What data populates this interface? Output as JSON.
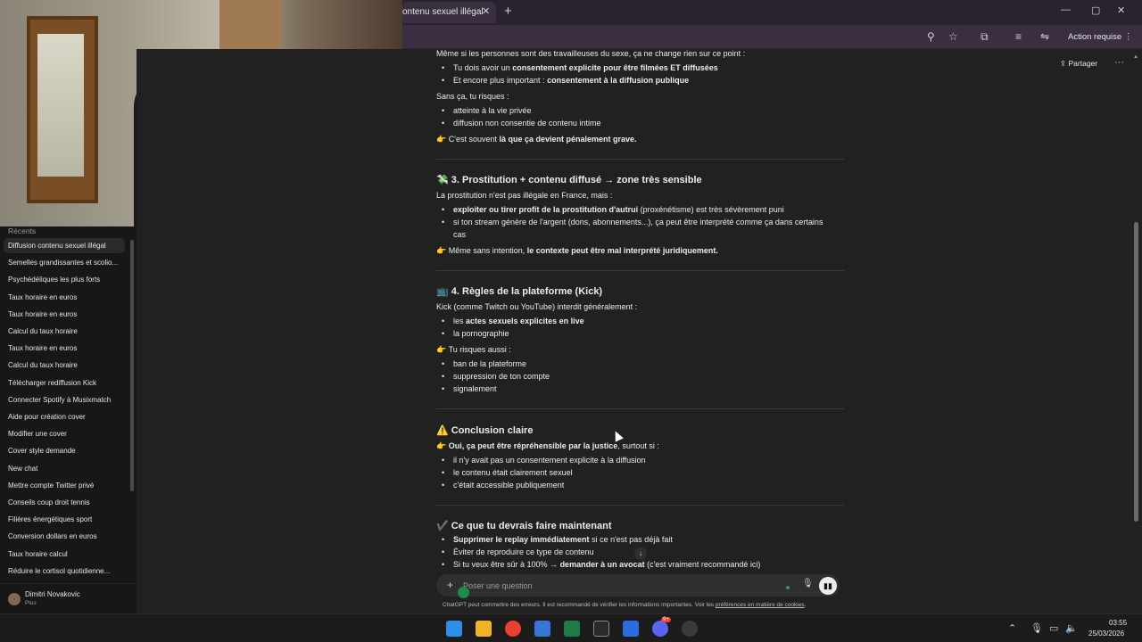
{
  "browser": {
    "tab_title": "ontenu sexuel illégal",
    "tab_close": "✕",
    "new_tab": "+",
    "window_controls": [
      "—",
      "▢",
      "✕"
    ],
    "action_button": "Action requise",
    "toolbar_icons": [
      "zoom-icon",
      "star-icon",
      "extensions-icon",
      "media-icon",
      "profile-icon",
      "menu-icon"
    ]
  },
  "header": {
    "share_label": "Partager",
    "more": "···"
  },
  "sidebar": {
    "recents_label": "Récents",
    "items": [
      {
        "label": "Diffusion contenu sexuel illégal",
        "active": true
      },
      {
        "label": "Semelles grandissantes et scolio..."
      },
      {
        "label": "Psychédéliques les plus forts"
      },
      {
        "label": "Taux horaire en euros"
      },
      {
        "label": "Taux horaire en euros"
      },
      {
        "label": "Calcul du taux horaire"
      },
      {
        "label": "Taux horaire en euros"
      },
      {
        "label": "Calcul du taux horaire"
      },
      {
        "label": "Télécharger rediffusion Kick"
      },
      {
        "label": "Connecter Spotify à Musixmatch"
      },
      {
        "label": "Aide pour création cover"
      },
      {
        "label": "Modifier une cover"
      },
      {
        "label": "Cover style demande"
      },
      {
        "label": "New chat"
      },
      {
        "label": "Mettre compte Twitter privé"
      },
      {
        "label": "Conseils coup droit tennis"
      },
      {
        "label": "Filières énergétiques sport"
      },
      {
        "label": "Conversion dollars en euros"
      },
      {
        "label": "Taux horaire calcul"
      },
      {
        "label": "Réduire le cortisol quotidienne..."
      }
    ],
    "user": {
      "name": "Dimitri Novakovic",
      "plan": "Plus"
    }
  },
  "content": {
    "intro": "Même si les personnes sont des travailleuses du sexe, ça ne change rien sur ce point :",
    "consent_bullets": [
      {
        "pre": "Tu dois avoir un ",
        "bold": "consentement explicite pour être filmées ET diffusées",
        "post": ""
      },
      {
        "pre": "Et encore plus important : ",
        "bold": "consentement à la diffusion publique",
        "post": ""
      }
    ],
    "risks_intro": "Sans ça, tu risques :",
    "risks": [
      "atteinte à la vie privée",
      "diffusion non consentie de contenu intime"
    ],
    "risk_note": {
      "emoji": "👉",
      "pre": "C'est souvent ",
      "bold": "là que ça devient pénalement grave.",
      "post": ""
    },
    "section3": {
      "emoji": "💸",
      "title": "3. Prostitution + contenu diffusé → zone très sensible",
      "intro": "La prostitution n'est pas illégale en France, mais :",
      "bullets": [
        {
          "bold": "exploiter ou tirer profit de la prostitution d'autrui",
          "post": " (proxénétisme) est très sévèrement puni"
        },
        {
          "bold": "",
          "post": "si ton stream génère de l'argent (dons, abonnements...), ça peut être interprété comme ça dans certains"
        },
        {
          "bold": "",
          "post": "cas"
        }
      ],
      "note": {
        "emoji": "👉",
        "pre": "Même sans intention, ",
        "bold": "le contexte peut être mal interprété juridiquement."
      }
    },
    "section4": {
      "emoji": "📺",
      "title": "4. Règles de la plateforme (Kick)",
      "intro": "Kick (comme Twitch ou YouTube) interdit généralement :",
      "bullets": [
        {
          "pre": "les ",
          "bold": "actes sexuels explicites en live"
        },
        {
          "pre": "la pornographie",
          "bold": ""
        }
      ],
      "risks_label": {
        "emoji": "👉",
        "text": "Tu risques aussi :"
      },
      "risks": [
        "ban de la plateforme",
        "suppression de ton compte",
        "signalement"
      ]
    },
    "conclusion": {
      "emoji": "⚠️",
      "title": "Conclusion claire",
      "lead": {
        "emoji": "👉",
        "bold": "Oui, ça peut être répréhensible par la justice",
        "post": ", surtout si :"
      },
      "bullets": [
        "il n'y avait pas un consentement explicite à la diffusion",
        "le contenu était clairement sexuel",
        "c'était accessible publiquement"
      ]
    },
    "todo": {
      "emoji": "✔️",
      "title": "Ce que tu devrais faire maintenant",
      "bullets": [
        {
          "bold": "Supprimer le replay immédiatement",
          "post": " si ce n'est pas déjà fait"
        },
        {
          "bold": "",
          "post": "Éviter de reproduire ce type de contenu"
        },
        {
          "bold": "",
          "pre": "Si tu veux être sûr à 100% → ",
          "bold2": "demander à un avocat",
          "post": " (c'est vraiment recommandé ici)"
        }
      ]
    }
  },
  "composer": {
    "placeholder": "Poser une question",
    "plus": "+",
    "mic": "🎙",
    "voice": "▮▮"
  },
  "disclaimer": {
    "text": "ChatGPT peut commettre des erreurs. Il est recommandé de vérifier les informations importantes. Voir les ",
    "link": "préférences en matière de cookies",
    "end": "."
  },
  "taskbar": {
    "time": "03:55",
    "date": "25/03/2026",
    "colors": {
      "windows": "#2f8fe8",
      "explorer": "#f0b429",
      "chrome": "#e94235",
      "store": "#3a76d6",
      "excel": "#1f7a45",
      "epic": "#2a2a2a",
      "fb": "#2d6cdf",
      "discord": "#5865f2",
      "obs": "#3a3a3a"
    },
    "discord_badge": "9+"
  },
  "colors": {
    "bg": "#212121",
    "sidebar": "#171717",
    "tab": "#3a2f40"
  }
}
